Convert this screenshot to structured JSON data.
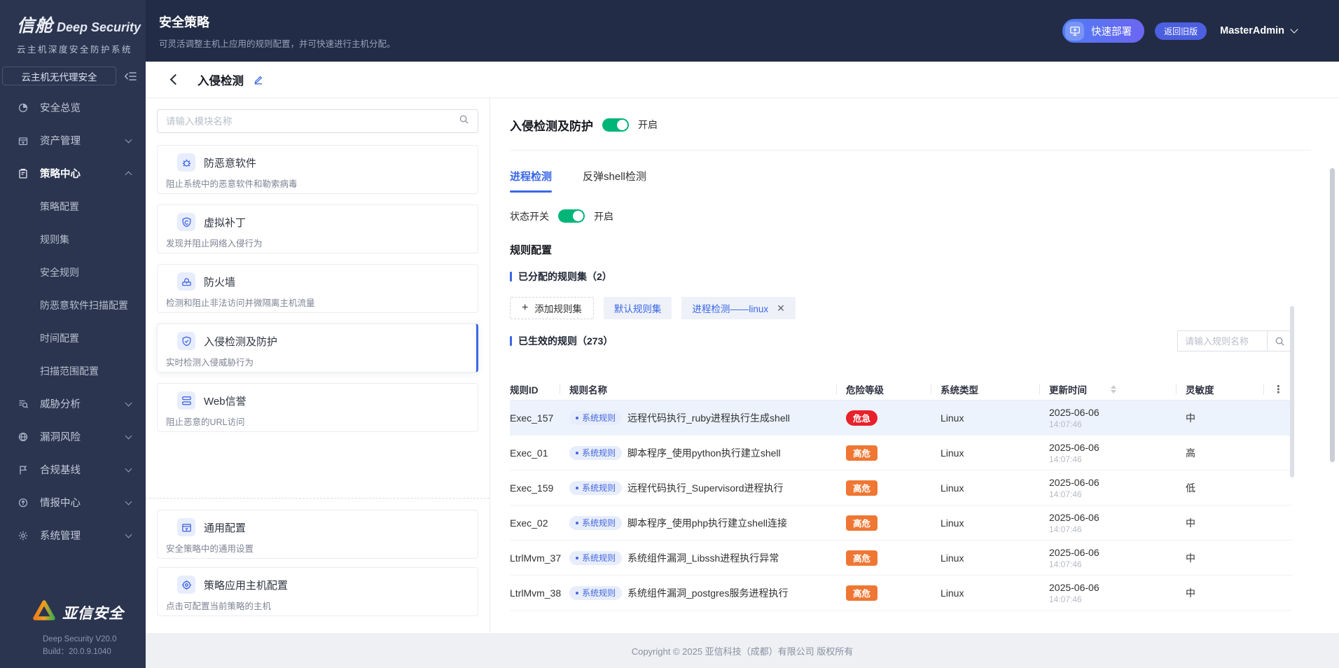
{
  "brand": {
    "logo_zh": "信舱",
    "logo_en": "Deep Security",
    "tagline": "云主机深度安全防护系统",
    "mode": "云主机无代理安全",
    "vendor": "亚信安全",
    "version": "Deep Security V20.0",
    "build": "Build：20.0.9.1040"
  },
  "sidebar": {
    "items": [
      {
        "label": "安全总览"
      },
      {
        "label": "资产管理"
      },
      {
        "label": "策略中心"
      },
      {
        "label": "策略配置"
      },
      {
        "label": "规则集"
      },
      {
        "label": "安全规则"
      },
      {
        "label": "防恶意软件扫描配置"
      },
      {
        "label": "时间配置"
      },
      {
        "label": "扫描范围配置"
      },
      {
        "label": "威胁分析"
      },
      {
        "label": "漏洞风险"
      },
      {
        "label": "合规基线"
      },
      {
        "label": "情报中心"
      },
      {
        "label": "系统管理"
      }
    ]
  },
  "topbar": {
    "title": "安全策略",
    "subtitle": "可灵活调整主机上应用的规则配置，并可快速进行主机分配。",
    "quick_deploy": "快速部署",
    "back_to_old": "返回旧版",
    "user": "MasterAdmin"
  },
  "breadcrumb": {
    "title": "入侵检测"
  },
  "module_panel": {
    "search_placeholder": "请输入模块名称",
    "modules": [
      {
        "title": "防恶意软件",
        "desc": "阻止系统中的恶意软件和勒索病毒"
      },
      {
        "title": "虚拟补丁",
        "desc": "发现并阻止网络入侵行为"
      },
      {
        "title": "防火墙",
        "desc": "检测和阻止非法访问并微隔离主机流量"
      },
      {
        "title": "入侵检测及防护",
        "desc": "实时检测入侵威胁行为"
      },
      {
        "title": "Web信誉",
        "desc": "阻止恶意的URL访问"
      }
    ],
    "extras": [
      {
        "title": "通用配置",
        "desc": "安全策略中的通用设置"
      },
      {
        "title": "策略应用主机配置",
        "desc": "点击可配置当前策略的主机"
      }
    ]
  },
  "detail": {
    "title": "入侵检测及防护",
    "status_text": "开启",
    "tabs": [
      {
        "label": "进程检测"
      },
      {
        "label": "反弹shell检测"
      }
    ],
    "switch_label": "状态开关",
    "switch_status": "开启",
    "section_rule_config": "规则配置",
    "assigned_rulesets_title": "已分配的规则集（2）",
    "add_ruleset_label": "添加规则集",
    "rulesets": [
      {
        "label": "默认规则集"
      },
      {
        "label": "进程检测——linux"
      }
    ],
    "effective_rules_title": "已生效的规则（273）",
    "rule_search_placeholder": "请输入规则名称",
    "table": {
      "columns": [
        "规则ID",
        "规则名称",
        "危险等级",
        "系统类型",
        "更新时间",
        "灵敏度"
      ],
      "rows": [
        {
          "id": "Exec_157",
          "tag": "系统规则",
          "name": "远程代码执行_ruby进程执行生成shell",
          "level": "危急",
          "level_key": "critical",
          "os": "Linux",
          "date": "2025-06-06",
          "time": "14:07:46",
          "sensitivity": "中"
        },
        {
          "id": "Exec_01",
          "tag": "系统规则",
          "name": "脚本程序_使用python执行建立shell",
          "level": "高危",
          "level_key": "high",
          "os": "Linux",
          "date": "2025-06-06",
          "time": "14:07:46",
          "sensitivity": "高"
        },
        {
          "id": "Exec_159",
          "tag": "系统规则",
          "name": "远程代码执行_Supervisord进程执行",
          "level": "高危",
          "level_key": "high",
          "os": "Linux",
          "date": "2025-06-06",
          "time": "14:07:46",
          "sensitivity": "低"
        },
        {
          "id": "Exec_02",
          "tag": "系统规则",
          "name": "脚本程序_使用php执行建立shell连接",
          "level": "高危",
          "level_key": "high",
          "os": "Linux",
          "date": "2025-06-06",
          "time": "14:07:46",
          "sensitivity": "中"
        },
        {
          "id": "LtrlMvm_37",
          "tag": "系统规则",
          "name": "系统组件漏洞_Libssh进程执行异常",
          "level": "高危",
          "level_key": "high",
          "os": "Linux",
          "date": "2025-06-06",
          "time": "14:07:46",
          "sensitivity": "中"
        },
        {
          "id": "LtrlMvm_38",
          "tag": "系统规则",
          "name": "系统组件漏洞_postgres服务进程执行",
          "level": "高危",
          "level_key": "high",
          "os": "Linux",
          "date": "2025-06-06",
          "time": "14:07:46",
          "sensitivity": "中"
        }
      ]
    }
  },
  "footer": {
    "copyright": "Copyright © 2025 亚信科技（成都）有限公司 版权所有"
  },
  "colors": {
    "accent": "#3a67e8",
    "toggle_on": "#00b578",
    "critical": "#e8212a",
    "high": "#ef7733",
    "sidebar_bg": "#2b3550",
    "header_bg": "#222c46"
  }
}
